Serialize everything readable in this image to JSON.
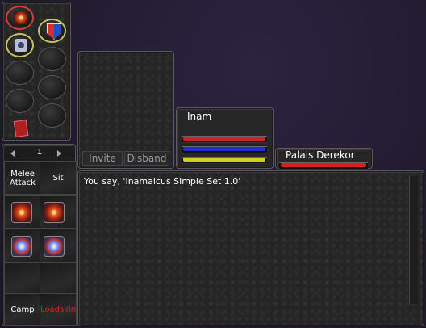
{
  "hotbar": {
    "page_number": "1",
    "prev_icon": "left-arrow-icon",
    "next_icon": "right-arrow-icon",
    "melee_label": "Melee Attack",
    "sit_label": "Sit",
    "camp_label": "Camp",
    "loadskin_label": "Loadskin",
    "loadskin_color": "#e02020"
  },
  "group": {
    "invite_label": "Invite",
    "disband_label": "Disband"
  },
  "player": {
    "name": "Inam",
    "hp_color": "#d42020",
    "mana_color": "#2030d0",
    "stamina_color": "#d0d020"
  },
  "target": {
    "name": "Palais Derekor",
    "hp_color": "#d42020"
  },
  "chat": {
    "lines": [
      "You say, 'Inamalcus Simple Set 1.0'"
    ]
  }
}
